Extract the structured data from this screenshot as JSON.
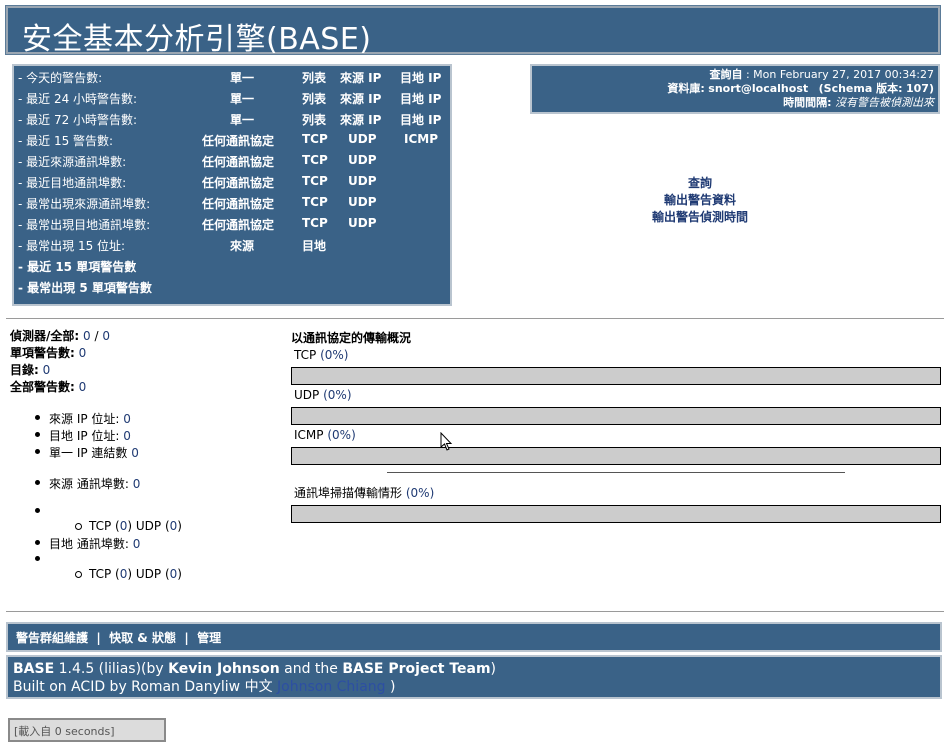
{
  "title": "安全基本分析引擎(BASE)",
  "nav": {
    "rows": [
      {
        "label": "- 今天的警告數:",
        "cols": [
          "單一",
          "列表",
          "來源 IP",
          "目地 IP"
        ]
      },
      {
        "label": "- 最近 24 小時警告數:",
        "cols": [
          "單一",
          "列表",
          "來源 IP",
          "目地 IP"
        ]
      },
      {
        "label": "- 最近 72 小時警告數:",
        "cols": [
          "單一",
          "列表",
          "來源 IP",
          "目地 IP"
        ]
      },
      {
        "label": "- 最近 15 警告數:",
        "cols": [
          "任何通訊協定",
          "TCP",
          "UDP",
          "ICMP"
        ]
      },
      {
        "label": "- 最近來源通訊埠數:",
        "cols": [
          "任何通訊協定",
          "TCP",
          "UDP"
        ]
      },
      {
        "label": "- 最近目地通訊埠數:",
        "cols": [
          "任何通訊協定",
          "TCP",
          "UDP"
        ]
      },
      {
        "label": "- 最常出現來源通訊埠數:",
        "cols": [
          "任何通訊協定",
          "TCP",
          "UDP"
        ]
      },
      {
        "label": "- 最常出現目地通訊埠數:",
        "cols": [
          "任何通訊協定",
          "TCP",
          "UDP"
        ]
      },
      {
        "label": "- 最常出現 15 位址:",
        "cols": [
          "來源",
          "目地"
        ]
      },
      {
        "label": "- 最近 15 單項警告數",
        "cols": []
      },
      {
        "label": "- 最常出現 5 單項警告數",
        "cols": []
      }
    ]
  },
  "info": {
    "query_label": "查詢自",
    "query_value": ": Mon February 27, 2017 00:34:27",
    "db_label": "資料庫:",
    "db_value": "snort@localhost",
    "schema_label": "(Schema 版本:",
    "schema_value": "107)",
    "interval_label": "時間間隔:",
    "interval_value": "沒有警告被偵測出來"
  },
  "center_links": [
    "查詢",
    "輸出警告資料",
    "輸出警告偵測時間"
  ],
  "stats": {
    "sensors_label": "偵測器/全部:",
    "sensors_value": "0",
    "sensors_sep": " / ",
    "sensors_total": "0",
    "unique_label": "單項警告數:",
    "unique_value": "0",
    "categories_label": "目錄:",
    "categories_value": "0",
    "total_label": "全部警告數:",
    "total_value": "0",
    "src_ip_label": "來源 IP 位址:",
    "src_ip_value": "0",
    "dst_ip_label": "目地 IP 位址:",
    "dst_ip_value": "0",
    "unique_ip_label": "單一 IP 連結數",
    "unique_ip_value": "0",
    "src_port_label": "來源 通訊埠數:",
    "src_port_value": "0",
    "src_tcp_label": "TCP (",
    "src_tcp_value": "0",
    "src_udp_label": ") UDP (",
    "src_udp_value": "0",
    "close": ")",
    "dst_port_label": "目地 通訊埠數:",
    "dst_port_value": "0",
    "dst_tcp_label": "TCP (",
    "dst_tcp_value": "0",
    "dst_udp_label": ") UDP (",
    "dst_udp_value": "0"
  },
  "traffic": {
    "heading": "以通訊協定的傳輸概況",
    "protocols": [
      {
        "name": "TCP",
        "pct": "(0%)",
        "fill": 0
      },
      {
        "name": "UDP",
        "pct": "(0%)",
        "fill": 0
      },
      {
        "name": "ICMP",
        "pct": "(0%)",
        "fill": 0
      }
    ],
    "portscan_label": "通訊埠掃描傳輸情形",
    "portscan_pct": "(0%)",
    "portscan_fill": 0
  },
  "menu": {
    "item1": "警告群組維護",
    "sep": "|",
    "item2": "快取 & 狀態",
    "item3": "管理"
  },
  "credits": {
    "base": "BASE",
    "version": " 1.4.5 (lilias)(by ",
    "author": "Kevin Johnson",
    "and": " and the ",
    "team": "BASE Project Team",
    "line2": "Built on ACID by Roman Danyliw 中文",
    "translator": "Johnson Chiang",
    "close": " )"
  },
  "loadtime": "[載入自 0 seconds]"
}
